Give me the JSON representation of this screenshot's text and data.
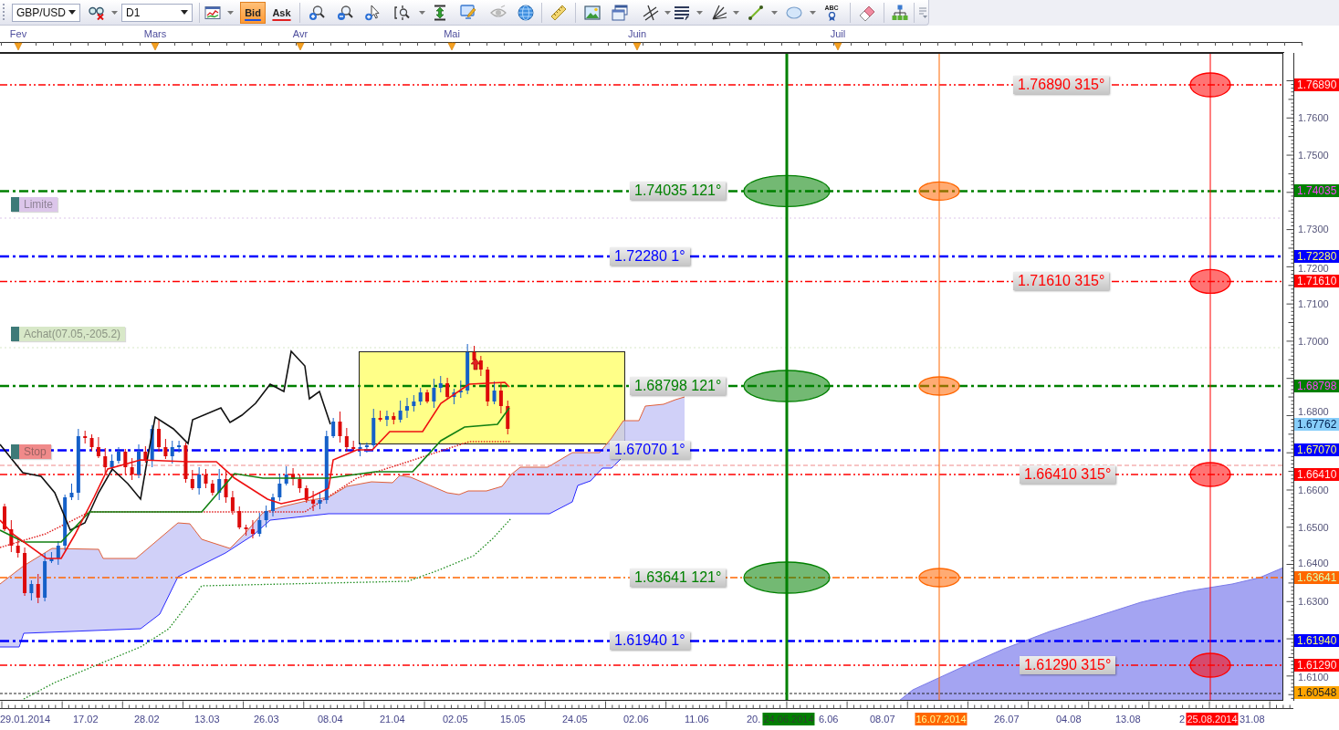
{
  "toolbar": {
    "symbol": {
      "value": "GBP/USD"
    },
    "timeframe": {
      "value": "D1"
    },
    "price_buttons": [
      {
        "label": "Bid",
        "selected": true
      },
      {
        "label": "Ask",
        "selected": false
      }
    ],
    "text_tool": {
      "label": "ABC"
    }
  },
  "month_axis": {
    "labels": [
      "Fev",
      "Mars",
      "Avr",
      "Mai",
      "Juin",
      "Juil"
    ]
  },
  "chart": {
    "orders": [
      {
        "label": "Limite",
        "color": "#dcc6ea"
      },
      {
        "label": "Achat(07.05,-205.2)",
        "color": "#d8e8c8"
      },
      {
        "label": "Stop",
        "color": "#f08a8a"
      }
    ],
    "levels": [
      {
        "label": "1.76890 315°",
        "color": "#ff0000"
      },
      {
        "label": "1.74035 121°",
        "color": "#008000"
      },
      {
        "label": "1.72280 1°",
        "color": "#0000ff"
      },
      {
        "label": "1.71610 315°",
        "color": "#ff0000"
      },
      {
        "label": "1.68798 121°",
        "color": "#008000"
      },
      {
        "label": "1.67070 1°",
        "color": "#0000ff"
      },
      {
        "label": "1.66410 315°",
        "color": "#ff0000"
      },
      {
        "label": "1.63641 121°",
        "color": "#008000"
      },
      {
        "label": "1.61940 1°",
        "color": "#0000ff"
      },
      {
        "label": "1.61290 315°",
        "color": "#ff0000"
      }
    ],
    "time_lines": [
      {
        "label": "24.06.2014",
        "color": "#008000"
      },
      {
        "label": "16.07.2014",
        "color": "#ff6600"
      },
      {
        "label": "25.08.2014",
        "color": "#ff0000"
      }
    ]
  },
  "price_axis": {
    "ticks": [
      "1.7600",
      "1.7500",
      "1.7300",
      "1.7200",
      "1.7100",
      "1.7000",
      "1.6800",
      "1.6600",
      "1.6500",
      "1.6400",
      "1.6300",
      "1.6100"
    ],
    "tags": [
      {
        "text": "1.76890",
        "color": "#ff0000"
      },
      {
        "text": "1.74035",
        "color": "#008000"
      },
      {
        "text": "1.72280",
        "color": "#0000ff"
      },
      {
        "text": "1.71610",
        "color": "#ff0000"
      },
      {
        "text": "1.68798",
        "color": "#008000"
      },
      {
        "text": "1.67762",
        "color": "#87cefa"
      },
      {
        "text": "1.67070",
        "color": "#0000ff"
      },
      {
        "text": "1.66410",
        "color": "#ff0000"
      },
      {
        "text": "1.63641",
        "color": "#ff6600"
      },
      {
        "text": "1.61940",
        "color": "#0000ff"
      },
      {
        "text": "1.61290",
        "color": "#ff0000"
      },
      {
        "text": "1.60548",
        "color": "#ffa500"
      }
    ]
  },
  "date_axis": {
    "labels": [
      "29.01.2014",
      "17.02",
      "28.02",
      "13.03",
      "26.03",
      "08.04",
      "21.04",
      "02.05",
      "15.05",
      "24.05",
      "02.06",
      "11.06",
      "20.",
      "6.06",
      "08.07",
      "26.07",
      "04.08",
      "13.08",
      "2",
      "31.08"
    ]
  }
}
